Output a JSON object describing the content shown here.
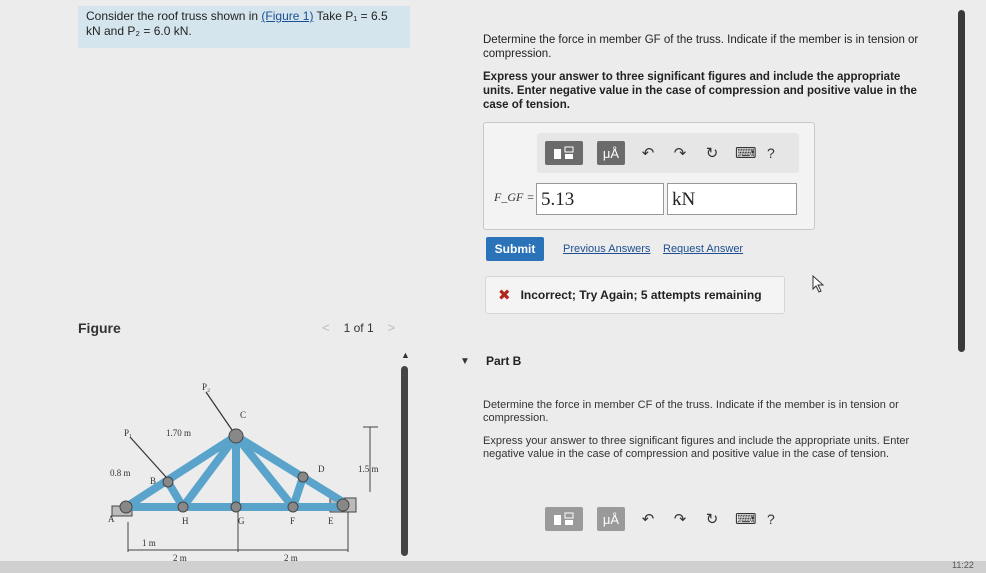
{
  "statement": {
    "line1": "Consider the roof truss shown in ",
    "figure_link": "(Figure 1)",
    "line1_tail": " Take P₁ = 6.5",
    "line2": "kN and P₂ = 6.0 kN."
  },
  "figure": {
    "label": "Figure",
    "pager": "1 of 1",
    "prev_arrow": "<",
    "next_arrow": ">",
    "labels": {
      "p1": "P₁",
      "p2": "P₂",
      "a": "A",
      "b": "B",
      "c": "C",
      "d": "D",
      "e": "E",
      "g": "G",
      "h": "H",
      "f": "F",
      "dim_170": "1.70 m",
      "dim_08": "0.8 m",
      "dim_15": "1.5 m",
      "dim_1": "1 m",
      "dim_2a": "2 m",
      "dim_2b": "2 m"
    }
  },
  "part_a": {
    "question": "Determine the force in member GF of the truss. Indicate if the member is in tension or compression.",
    "instructions": "Express your answer to three significant figures and include the appropriate units. Enter negative value in the case of compression and positive value in the case of tension.",
    "toolbar": {
      "templates_icon": "templates-icon",
      "units_label": "μÅ",
      "undo": "↶",
      "redo": "↷",
      "reset": "↻",
      "keyboard": "⌨",
      "help": "?"
    },
    "field_label": "F_GF =",
    "value": "5.13",
    "units": "kN",
    "submit_label": "Submit",
    "previous_answers": "Previous Answers",
    "request_answer": "Request Answer",
    "feedback": "Incorrect; Try Again; 5 attempts remaining",
    "feedback_icon": "✖"
  },
  "part_b": {
    "caret": "▼",
    "title": "Part B",
    "question": "Determine the force in member CF of the truss. Indicate if the member is in tension or compression.",
    "instructions": "Express your answer to three significant figures and include the appropriate units. Enter negative value in the case of compression and positive value in the case of tension.",
    "toolbar": {
      "units_label": "μÅ",
      "undo": "↶",
      "redo": "↷",
      "reset": "↻",
      "keyboard": "⌨",
      "help": "?"
    }
  },
  "clock": "11:22",
  "colors": {
    "statement_bg": "#d5e5ee",
    "submit_bg": "#2a73b8",
    "link": "#1d4f91",
    "error": "#b3261e"
  }
}
